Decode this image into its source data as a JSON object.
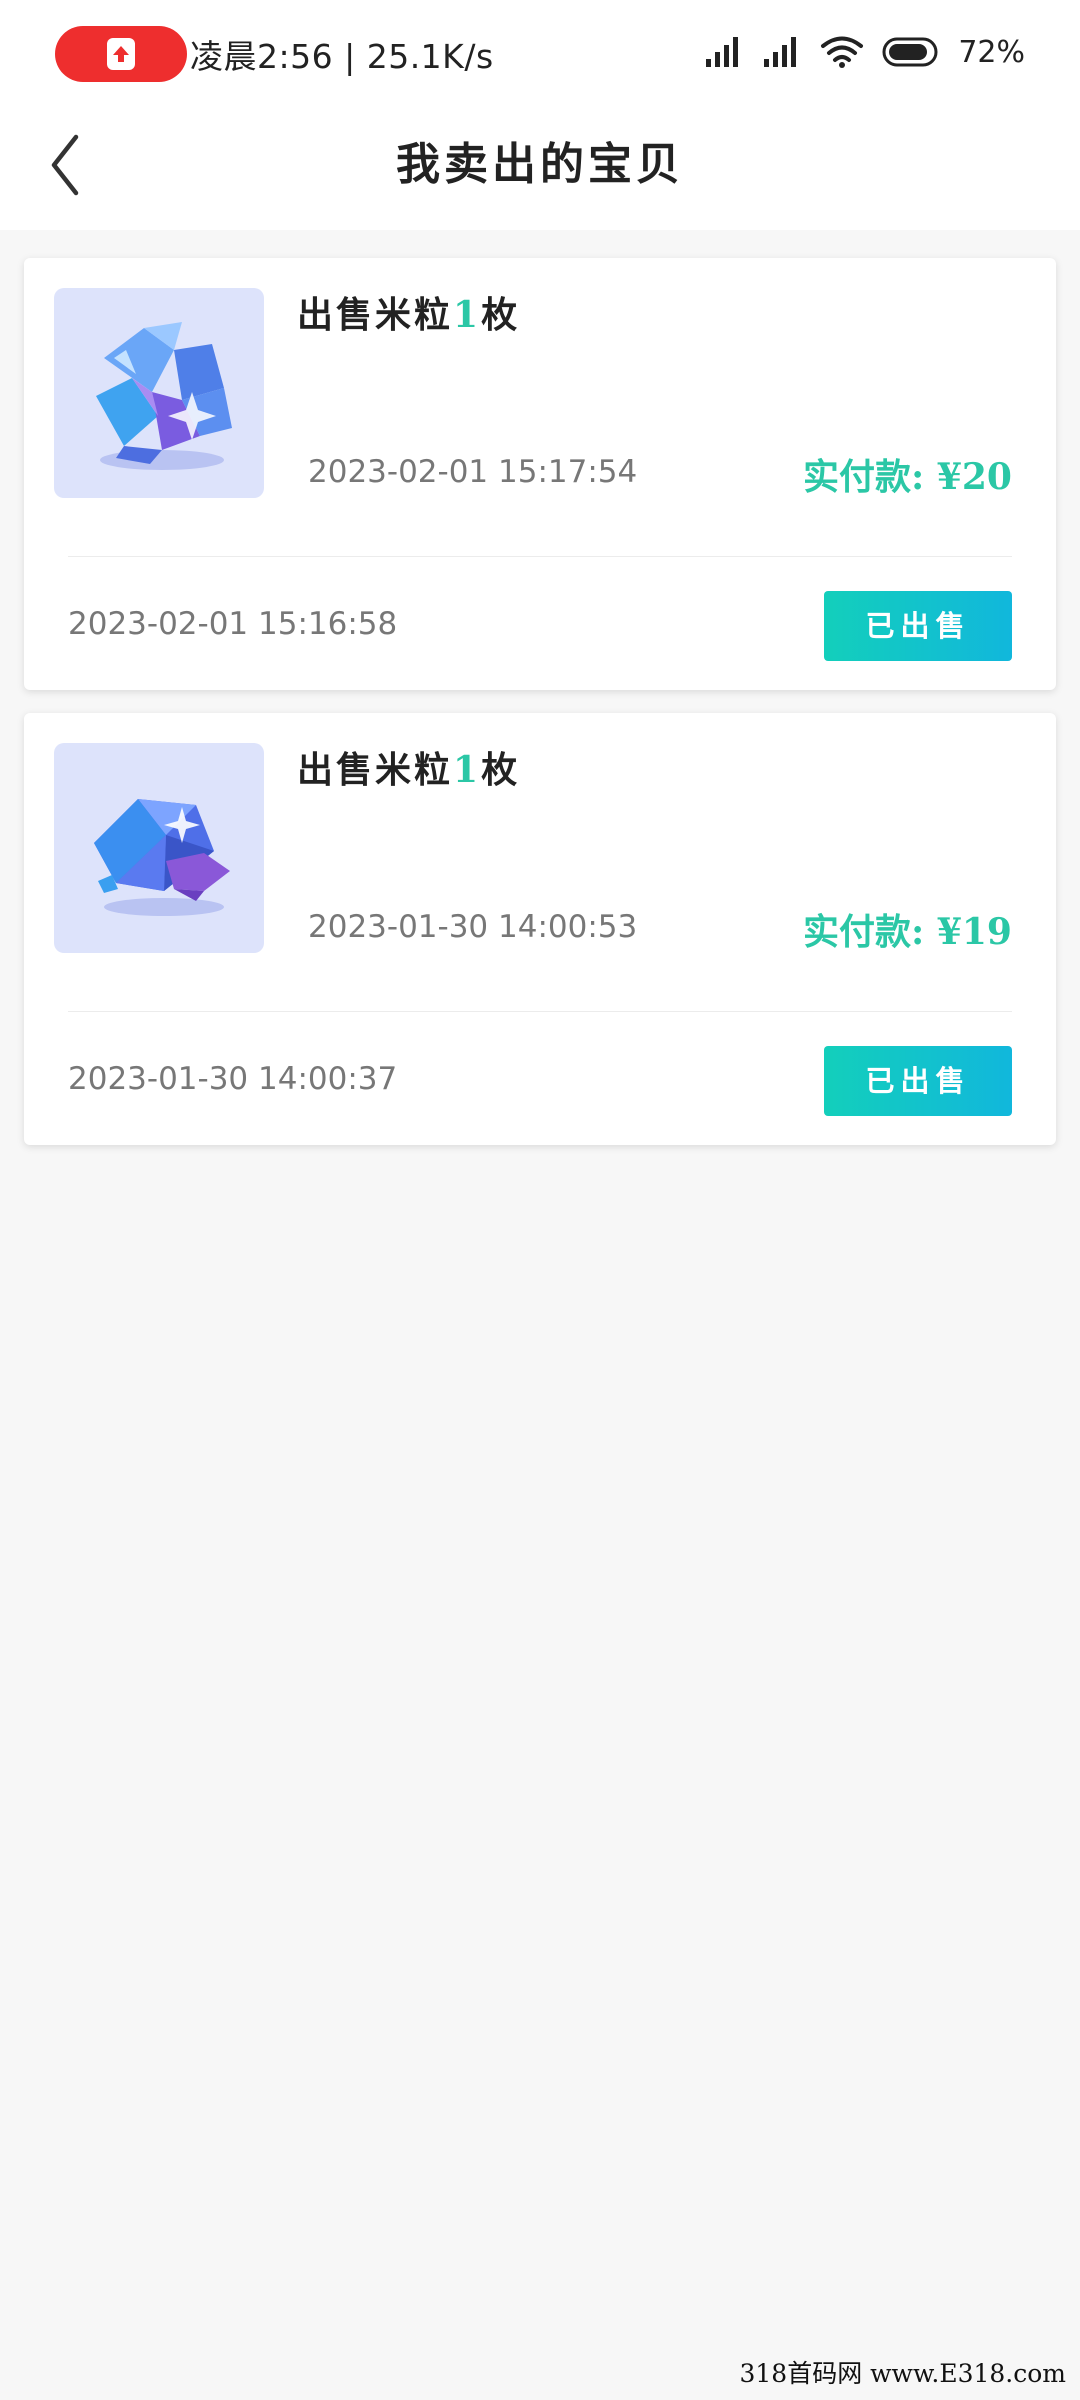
{
  "status_bar": {
    "time_speed": "凌晨2:56 | 25.1K/s",
    "battery": "72%"
  },
  "header": {
    "title": "我卖出的宝贝"
  },
  "orders": [
    {
      "title_prefix": "出售米粒",
      "quantity": "1",
      "title_suffix": "枚",
      "pay_time": "2023-02-01  15:17:54",
      "pay_amount": "实付款: ¥20",
      "order_time": "2023-02-01  15:16:58",
      "status_button": "已出售",
      "image_icon": "crystal-cluster-icon"
    },
    {
      "title_prefix": "出售米粒",
      "quantity": "1",
      "title_suffix": "枚",
      "pay_time": "2023-01-30  14:00:53",
      "pay_amount": "实付款: ¥19",
      "order_time": "2023-01-30  14:00:37",
      "status_button": "已出售",
      "image_icon": "gem-icon"
    }
  ],
  "watermark": "318首码网 www.E318.com",
  "colors": {
    "accent": "#2bc7a6",
    "button_gradient_start": "#13cfbb",
    "button_gradient_end": "#11b7dc",
    "record_pill": "#ee2e2e"
  }
}
